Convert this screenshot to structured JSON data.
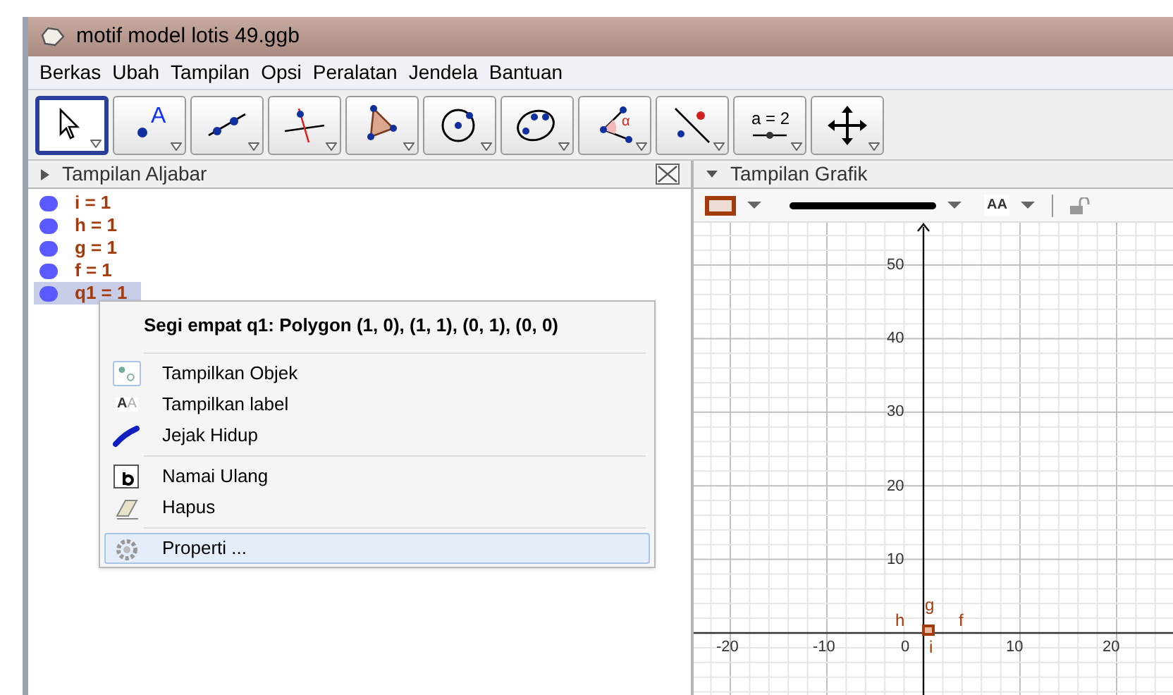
{
  "window": {
    "title": "motif model lotis 49.ggb"
  },
  "menu": [
    "Berkas",
    "Ubah",
    "Tampilan",
    "Opsi",
    "Peralatan",
    "Jendela",
    "Bantuan"
  ],
  "toolbar": [
    {
      "kind": "move",
      "selected": true
    },
    {
      "kind": "point",
      "selected": false,
      "text": "A"
    },
    {
      "kind": "line",
      "selected": false
    },
    {
      "kind": "perpendicular",
      "selected": false
    },
    {
      "kind": "polygon",
      "selected": false
    },
    {
      "kind": "circle",
      "selected": false
    },
    {
      "kind": "ellipse",
      "selected": false
    },
    {
      "kind": "angle",
      "selected": false,
      "text": "α"
    },
    {
      "kind": "reflect",
      "selected": false
    },
    {
      "kind": "slider",
      "selected": false,
      "text": "a = 2"
    },
    {
      "kind": "move-view",
      "selected": false
    }
  ],
  "algebra": {
    "title": "Tampilan Aljabar",
    "items": [
      {
        "label": "i = 1",
        "selected": false,
        "color": "#5a5aff"
      },
      {
        "label": "h = 1",
        "selected": false,
        "color": "#5a5aff"
      },
      {
        "label": "g = 1",
        "selected": false,
        "color": "#5a5aff"
      },
      {
        "label": "f = 1",
        "selected": false,
        "color": "#5a5aff"
      },
      {
        "label": "q1 = 1",
        "selected": true,
        "color": "#5a5aff"
      }
    ]
  },
  "context_menu": {
    "title": "Segi empat q1: Polygon (1, 0), (1, 1), (0, 1), (0, 0)",
    "groups": [
      [
        {
          "kind": "show-object",
          "label": "Tampilkan Objek",
          "checked": true,
          "selected": false
        },
        {
          "kind": "show-label",
          "label": "Tampilkan label",
          "selected": false,
          "icon_text": [
            "A",
            "A"
          ]
        },
        {
          "kind": "trace",
          "label": "Jejak Hidup",
          "selected": false
        }
      ],
      [
        {
          "kind": "rename",
          "label": "Namai Ulang",
          "selected": false
        },
        {
          "kind": "delete",
          "label": "Hapus",
          "selected": false
        }
      ],
      [
        {
          "kind": "properties",
          "label": "Properti ...",
          "selected": true
        }
      ]
    ]
  },
  "graphics": {
    "title": "Tampilan Grafik",
    "style_bar": {
      "text_style": "AA"
    },
    "x_ticks": [
      "-20",
      "-10",
      "0",
      "10",
      "20"
    ],
    "y_ticks": [
      "50",
      "40",
      "30",
      "20",
      "10"
    ],
    "labels": [
      {
        "text": "g",
        "kind": "above"
      },
      {
        "text": "h",
        "kind": "left"
      },
      {
        "text": "f",
        "kind": "right"
      },
      {
        "text": "i",
        "kind": "below"
      }
    ]
  }
}
